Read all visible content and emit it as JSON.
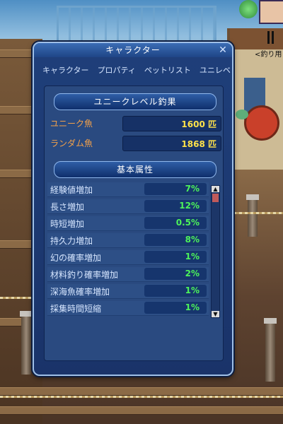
{
  "window": {
    "title": "キャラクター",
    "close_glyph": "✕"
  },
  "tabs": [
    {
      "label": "キャラクター"
    },
    {
      "label": "プロパティ"
    },
    {
      "label": "ペットリスト"
    },
    {
      "label": "ユニレベ"
    }
  ],
  "section_unique": {
    "title": "ユニークレベル釣果",
    "rows": [
      {
        "label": "ユニーク魚",
        "value": "1600 匹"
      },
      {
        "label": "ランダム魚",
        "value": "1868 匹"
      }
    ]
  },
  "section_stats": {
    "title": "基本属性",
    "rows": [
      {
        "label": "経験値増加",
        "value": "7%"
      },
      {
        "label": "長さ増加",
        "value": "12%"
      },
      {
        "label": "時短増加",
        "value": "0.5%"
      },
      {
        "label": "持久力増加",
        "value": "8%"
      },
      {
        "label": "幻の確率増加",
        "value": "1%"
      },
      {
        "label": "材料釣り確率増加",
        "value": "2%"
      },
      {
        "label": "深海魚確率増加",
        "value": "1%"
      },
      {
        "label": "採集時間短縮",
        "value": "1%"
      }
    ]
  },
  "hud": {
    "side_text": "<釣り用"
  },
  "colors": {
    "label_orange": "#f3a14a",
    "value_yellow": "#ffe24a",
    "value_green": "#4df25a"
  }
}
